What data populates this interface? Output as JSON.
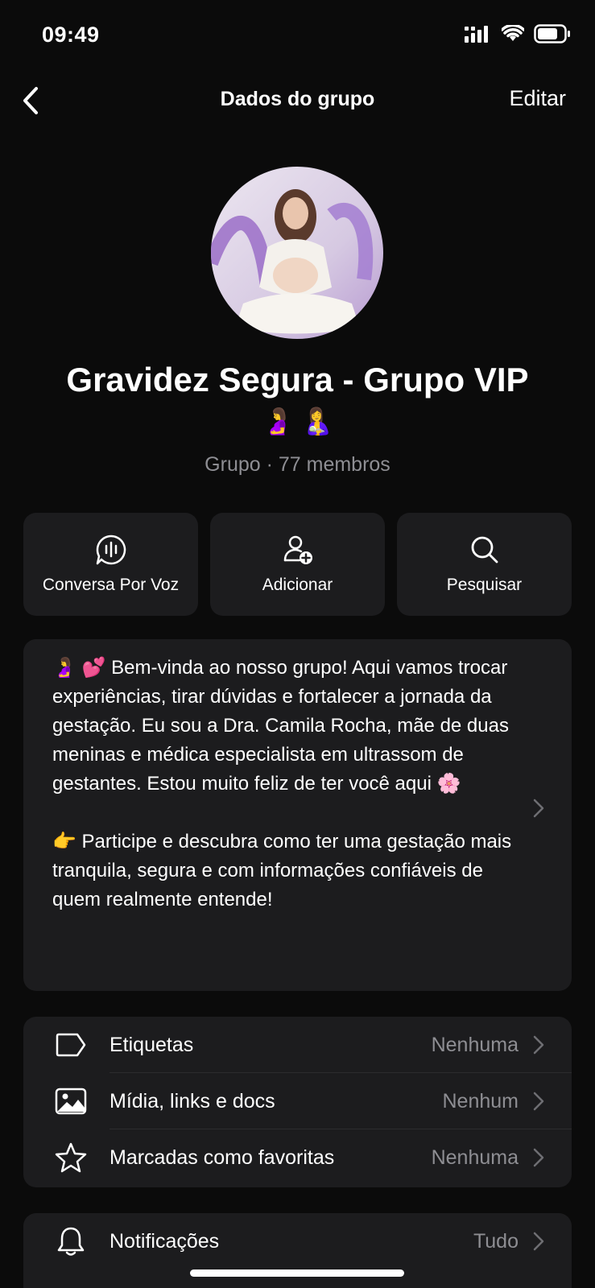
{
  "status_bar": {
    "time": "09:49"
  },
  "nav": {
    "title": "Dados do grupo",
    "edit_label": "Editar"
  },
  "group": {
    "name": "Gravidez Segura - Grupo VIP",
    "emojis": "🤰 🤱",
    "meta": "Grupo · 77 membros"
  },
  "actions": [
    {
      "label": "Conversa Por Voz",
      "icon": "voice-chat-icon"
    },
    {
      "label": "Adicionar",
      "icon": "add-person-icon"
    },
    {
      "label": "Pesquisar",
      "icon": "search-icon"
    }
  ],
  "description": "🤰 💕 Bem-vinda ao nosso grupo! Aqui vamos trocar experiências, tirar dúvidas e fortalecer a jornada da gestação. Eu sou a Dra. Camila Rocha, mãe de duas meninas e médica especialista em ultrassom de gestantes. Estou muito feliz de ter você aqui 🌸\n\n👉 Participe e descubra como ter uma gestação mais tranquila, segura e com informações confiáveis de quem realmente entende!",
  "list1": [
    {
      "label": "Etiquetas",
      "value": "Nenhuma",
      "icon": "tag-icon"
    },
    {
      "label": "Mídia, links e docs",
      "value": "Nenhum",
      "icon": "image-icon"
    },
    {
      "label": "Marcadas como favoritas",
      "value": "Nenhuma",
      "icon": "star-icon"
    }
  ],
  "list2": [
    {
      "label": "Notificações",
      "value": "Tudo",
      "icon": "bell-icon"
    }
  ],
  "colors": {
    "background": "#0b0b0b",
    "card": "#1c1c1e",
    "secondary_text": "#8e8e93"
  }
}
